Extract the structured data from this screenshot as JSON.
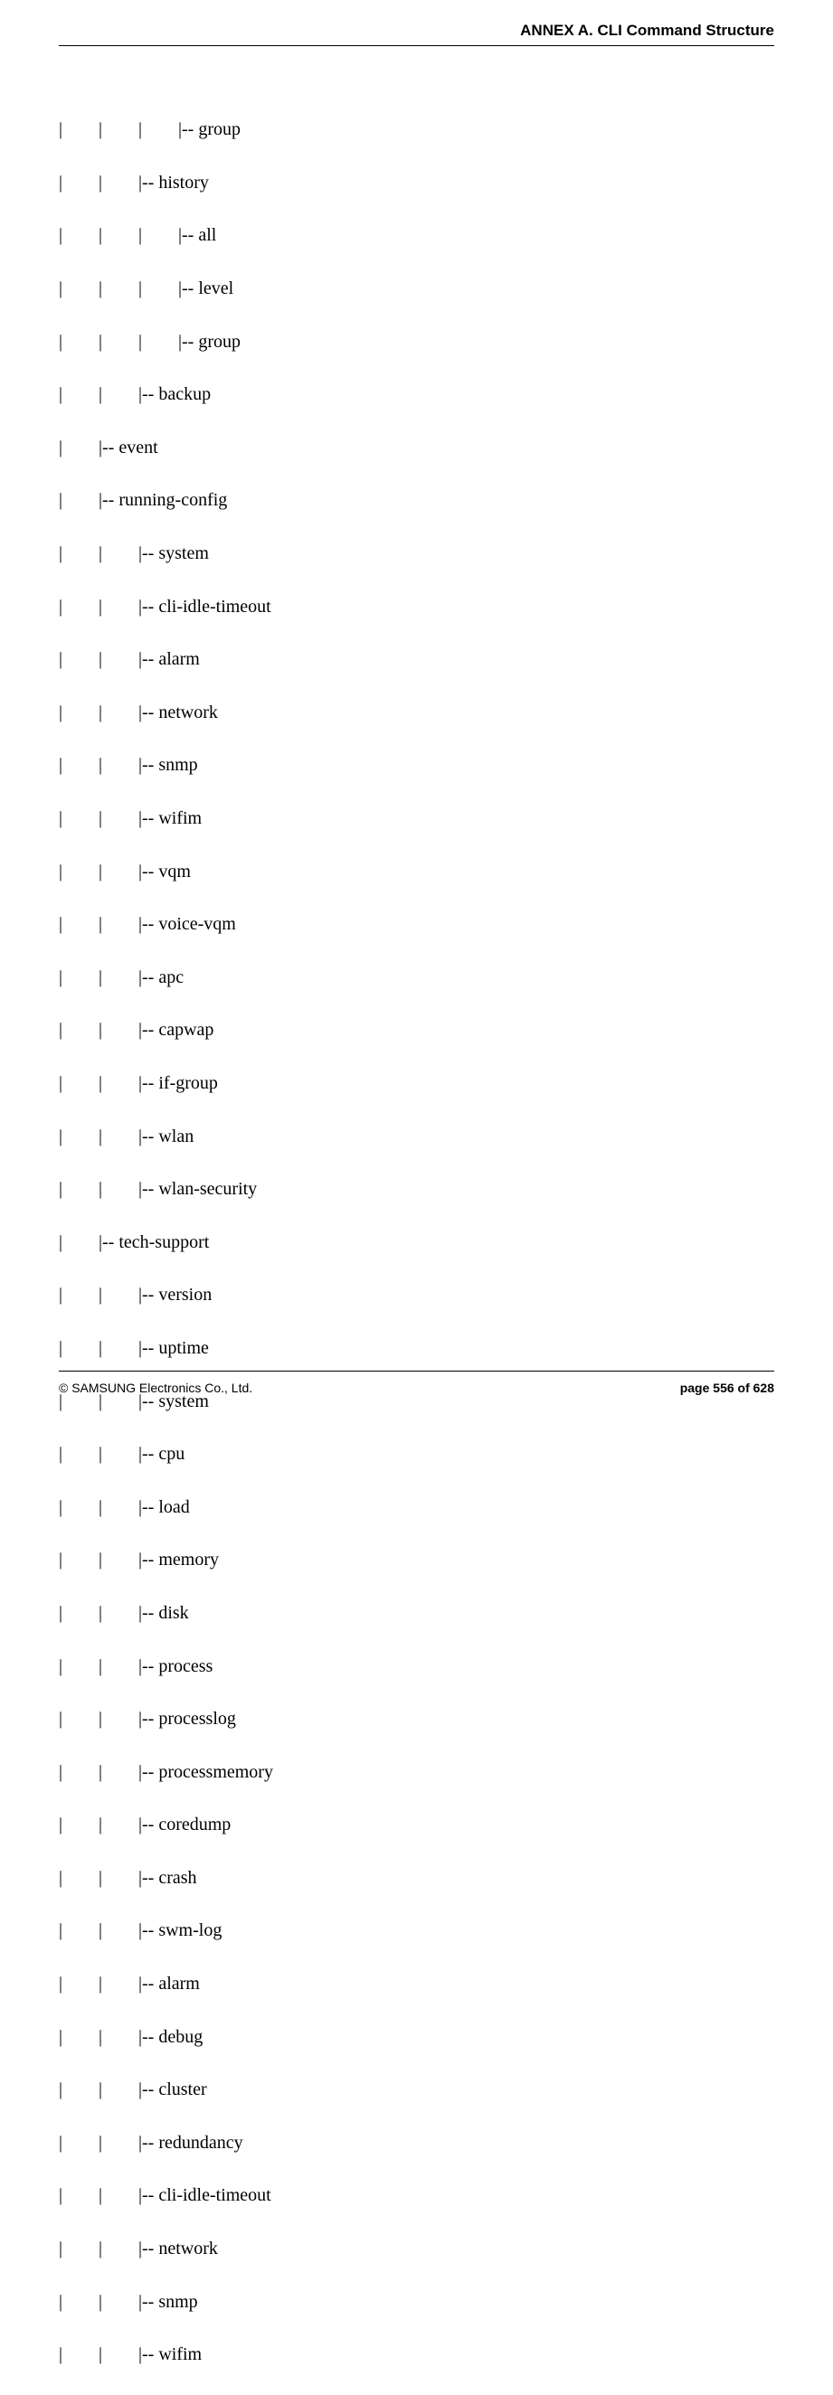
{
  "header": {
    "title": "ANNEX A. CLI Command Structure"
  },
  "tree": [
    "|        |        |        |-- group",
    "|        |        |-- history",
    "|        |        |        |-- all",
    "|        |        |        |-- level",
    "|        |        |        |-- group",
    "|        |        |-- backup",
    "|        |-- event",
    "|        |-- running-config",
    "|        |        |-- system",
    "|        |        |-- cli-idle-timeout",
    "|        |        |-- alarm",
    "|        |        |-- network",
    "|        |        |-- snmp",
    "|        |        |-- wifim",
    "|        |        |-- vqm",
    "|        |        |-- voice-vqm",
    "|        |        |-- apc",
    "|        |        |-- capwap",
    "|        |        |-- if-group",
    "|        |        |-- wlan",
    "|        |        |-- wlan-security",
    "|        |-- tech-support",
    "|        |        |-- version",
    "|        |        |-- uptime",
    "|        |        |-- system",
    "|        |        |-- cpu",
    "|        |        |-- load",
    "|        |        |-- memory",
    "|        |        |-- disk",
    "|        |        |-- process",
    "|        |        |-- processlog",
    "|        |        |-- processmemory",
    "|        |        |-- coredump",
    "|        |        |-- crash",
    "|        |        |-- swm-log",
    "|        |        |-- alarm",
    "|        |        |-- debug",
    "|        |        |-- cluster",
    "|        |        |-- redundancy",
    "|        |        |-- cli-idle-timeout",
    "|        |        |-- network",
    "|        |        |-- snmp",
    "|        |        |-- wifim"
  ],
  "footer": {
    "copyright": "© SAMSUNG Electronics Co., Ltd.",
    "page": "page 556 of 628"
  }
}
